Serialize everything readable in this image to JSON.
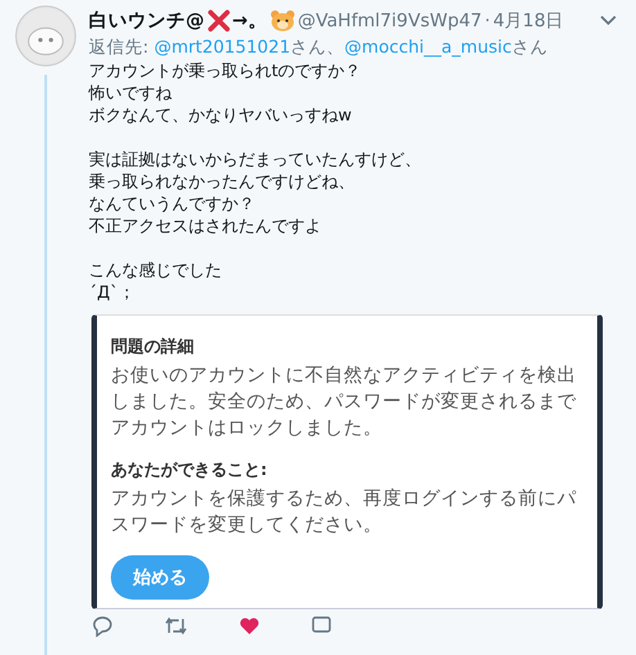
{
  "tweet": {
    "name_start": "白いウンチ@",
    "name_end": "→。",
    "handle": "@VaHfml7i9VsWp47",
    "separator": "·",
    "date": "4月18日",
    "reply_to": [
      {
        "kind": "text",
        "text": "返信先: "
      },
      {
        "kind": "link",
        "text": "@mrt20151021"
      },
      {
        "kind": "text",
        "text": "さん、"
      },
      {
        "kind": "link",
        "text": "@mocchi__a_music"
      },
      {
        "kind": "text",
        "text": "さん"
      }
    ],
    "body": [
      [
        "アカウントが乗っ取られtのですか？",
        "怖いですね",
        "ボクなんて、かなりヤバいっすねw"
      ],
      [
        "実は証拠はないからだまっていたんすけど、",
        "乗っ取られなかったんですけどね、",
        "なんていうんですか？",
        "不正アクセスはされたんですよ"
      ],
      [
        "こんな感じでした",
        "´Д`；"
      ]
    ],
    "card": {
      "title": "問題の詳細",
      "text": "お使いのアカウントに不自然なアクティビティを検出しました。安全のため、パスワードが変更されるまでアカウントはロックしました。",
      "subtitle": "あなたができること:",
      "subtext": "アカウントを保護するため、再度ログインする前にパスワードを変更してください。",
      "button": "始める"
    }
  }
}
